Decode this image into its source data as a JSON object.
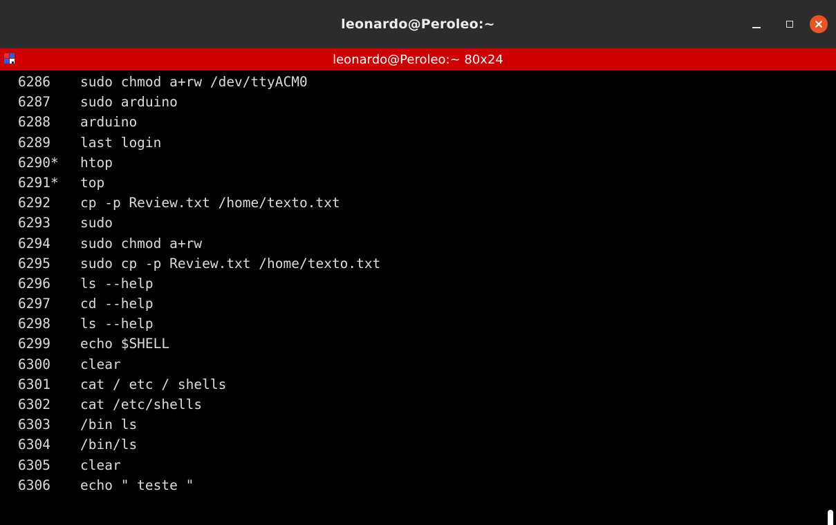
{
  "window": {
    "title": "leonardo@Peroleo:~"
  },
  "tab": {
    "title": "leonardo@Peroleo:~ 80x24",
    "icon": "terminal-split-icon"
  },
  "controls": {
    "minimize": "minimize-icon",
    "maximize": "maximize-icon",
    "close": "close-icon"
  },
  "colors": {
    "titlebar": "#2c2c2c",
    "banner": "#d00000",
    "close": "#e95420",
    "text": "#dcdcdc",
    "background": "#000000"
  },
  "history": [
    {
      "num": "6286",
      "cmd": "sudo chmod a+rw /dev/ttyACM0"
    },
    {
      "num": "6287",
      "cmd": "sudo arduino"
    },
    {
      "num": "6288",
      "cmd": "arduino"
    },
    {
      "num": "6289",
      "cmd": "last login"
    },
    {
      "num": "6290*",
      "cmd": "htop"
    },
    {
      "num": "6291*",
      "cmd": "top"
    },
    {
      "num": "6292",
      "cmd": "cp -p Review.txt /home/texto.txt"
    },
    {
      "num": "6293",
      "cmd": "sudo"
    },
    {
      "num": "6294",
      "cmd": "sudo chmod a+rw"
    },
    {
      "num": "6295",
      "cmd": "sudo cp -p Review.txt /home/texto.txt"
    },
    {
      "num": "6296",
      "cmd": "ls --help"
    },
    {
      "num": "6297",
      "cmd": "cd --help"
    },
    {
      "num": "6298",
      "cmd": "ls --help"
    },
    {
      "num": "6299",
      "cmd": "echo $SHELL"
    },
    {
      "num": "6300",
      "cmd": "clear"
    },
    {
      "num": "6301",
      "cmd": "cat / etc / shells"
    },
    {
      "num": "6302",
      "cmd": "cat /etc/shells"
    },
    {
      "num": "6303",
      "cmd": "/bin ls"
    },
    {
      "num": "6304",
      "cmd": "/bin/ls"
    },
    {
      "num": "6305",
      "cmd": "clear"
    },
    {
      "num": "6306",
      "cmd": "echo \" teste \""
    }
  ]
}
